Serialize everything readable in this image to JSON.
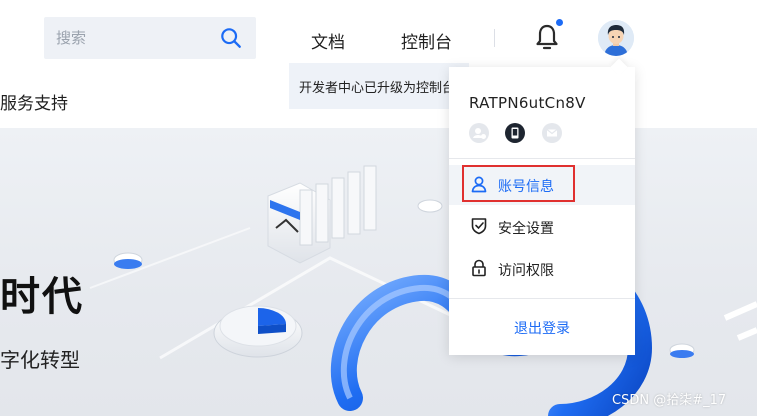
{
  "header": {
    "search": {
      "placeholder": "搜索",
      "value": ""
    },
    "nav": {
      "docs": "文档",
      "console": "控制台"
    },
    "notification_dot_color": "#1c6bf5",
    "icons": [
      "search-icon",
      "bell-icon",
      "avatar"
    ]
  },
  "subnav": {
    "item": "服务支持",
    "notice": "开发者中心已升级为控制台"
  },
  "banner": {
    "title": "时代",
    "subtitle": "字化转型"
  },
  "dropdown": {
    "username": "RATPN6utCn8V",
    "badges": [
      "user-verify-icon",
      "phone-icon",
      "mail-icon"
    ],
    "items": [
      {
        "label": "账号信息",
        "icon": "user-icon",
        "active": true
      },
      {
        "label": "安全设置",
        "icon": "shield-check-icon",
        "active": false
      },
      {
        "label": "访问权限",
        "icon": "lock-icon",
        "active": false
      }
    ],
    "logout": "退出登录"
  },
  "colors": {
    "accent": "#1c6bf5",
    "highlight": "#e0302f"
  },
  "watermark": "CSDN @拾柒#_17"
}
